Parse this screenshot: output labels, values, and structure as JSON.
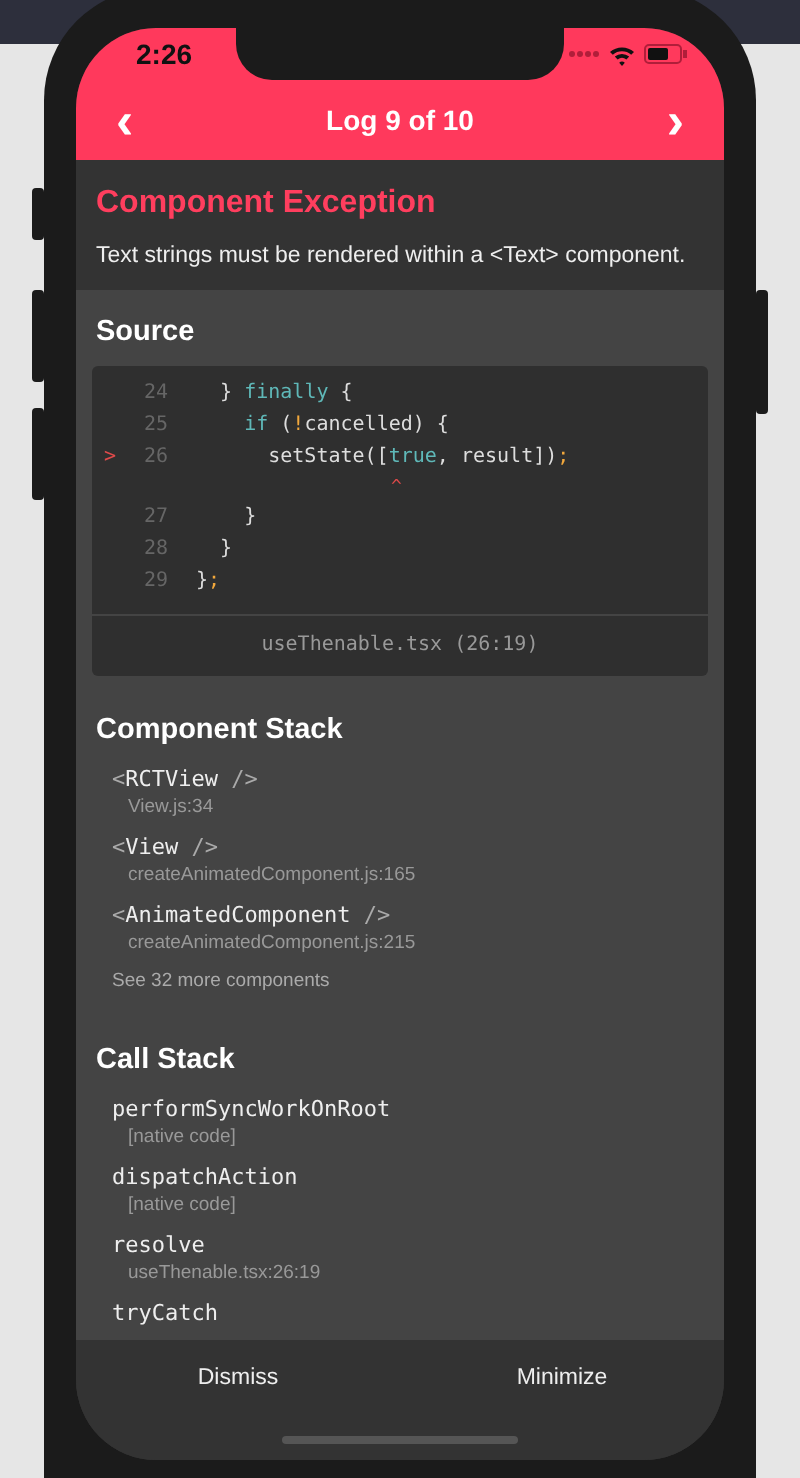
{
  "status_bar": {
    "time": "2:26"
  },
  "header": {
    "back": "‹",
    "title": "Log 9 of 10",
    "forward": "›"
  },
  "error": {
    "title": "Component Exception",
    "message": "Text strings must be rendered within a <Text> component."
  },
  "source": {
    "heading": "Source",
    "lines": [
      {
        "kind": "code",
        "number": "24",
        "tokens": [
          {
            "text": "  } ",
            "kind": "plain"
          },
          {
            "text": "finally",
            "kind": "keyword"
          },
          {
            "text": " {",
            "kind": "plain"
          }
        ]
      },
      {
        "kind": "code",
        "number": "25",
        "tokens": [
          {
            "text": "    if",
            "kind": "keyword"
          },
          {
            "text": " (",
            "kind": "plain"
          },
          {
            "text": "!",
            "kind": "operator"
          },
          {
            "text": "cancelled) {",
            "kind": "plain"
          }
        ]
      },
      {
        "kind": "code",
        "number": "26",
        "marker": ">",
        "tokens": [
          {
            "text": "      setState([",
            "kind": "plain"
          },
          {
            "text": "true",
            "kind": "keyword"
          },
          {
            "text": ", result])",
            "kind": "plain"
          },
          {
            "text": ";",
            "kind": "operator"
          }
        ]
      },
      {
        "kind": "caret",
        "text": "                  ^"
      },
      {
        "kind": "code",
        "number": "27",
        "tokens": [
          {
            "text": "    }",
            "kind": "plain"
          }
        ]
      },
      {
        "kind": "code",
        "number": "28",
        "tokens": [
          {
            "text": "  }",
            "kind": "plain"
          }
        ]
      },
      {
        "kind": "code",
        "number": "29",
        "tokens": [
          {
            "text": "}",
            "kind": "plain"
          },
          {
            "text": ";",
            "kind": "operator"
          }
        ]
      }
    ],
    "file": "useThenable.tsx (26:19)"
  },
  "component_stack": {
    "heading": "Component Stack",
    "items": [
      {
        "open": "<",
        "name": "RCTView",
        "close": " />",
        "location": "View.js:34"
      },
      {
        "open": "<",
        "name": "View",
        "close": " />",
        "location": "createAnimatedComponent.js:165"
      },
      {
        "open": "<",
        "name": "AnimatedComponent",
        "close": " />",
        "location": "createAnimatedComponent.js:215"
      }
    ],
    "more": "See 32 more components"
  },
  "call_stack": {
    "heading": "Call Stack",
    "items": [
      {
        "name": "performSyncWorkOnRoot",
        "location": "[native code]"
      },
      {
        "name": "dispatchAction",
        "location": "[native code]"
      },
      {
        "name": "resolve",
        "location": "useThenable.tsx:26:19"
      },
      {
        "name": "tryCatch"
      }
    ]
  },
  "footer": {
    "buttons": [
      "Dismiss",
      "Minimize"
    ]
  }
}
